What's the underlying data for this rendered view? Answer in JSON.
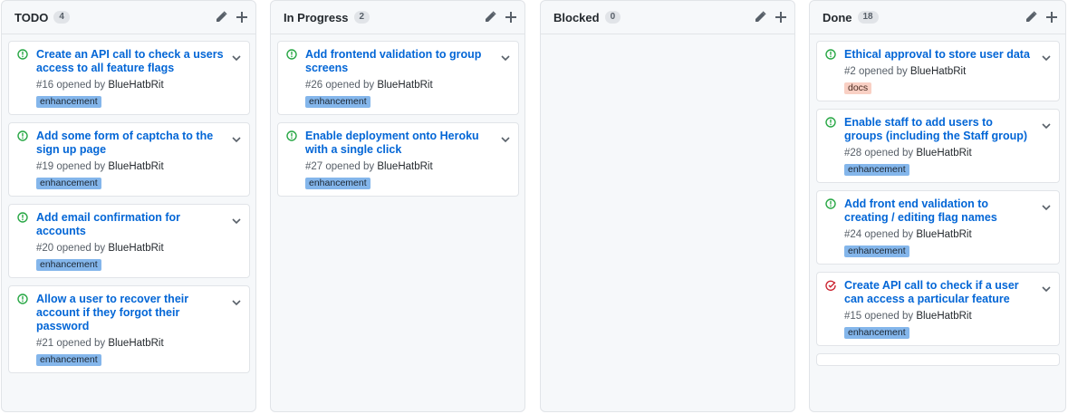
{
  "colors": {
    "open_icon": "#28a745",
    "closed_icon": "#cb2431",
    "title_link": "#0366d6",
    "enhancement_bg": "#84b6eb",
    "docs_bg": "#f9d0c4"
  },
  "columns": [
    {
      "title": "TODO",
      "count": "4",
      "cards": [
        {
          "title": "Create an API call to check a users access to all feature flags",
          "number": "#16",
          "opened_by": "opened by",
          "author": "BlueHatbRit",
          "label": "enhancement",
          "icon": "issue-opened-icon"
        },
        {
          "title": "Add some form of captcha to the sign up page",
          "number": "#19",
          "opened_by": "opened by",
          "author": "BlueHatbRit",
          "label": "enhancement",
          "icon": "issue-opened-icon"
        },
        {
          "title": "Add email confirmation for accounts",
          "number": "#20",
          "opened_by": "opened by",
          "author": "BlueHatbRit",
          "label": "enhancement",
          "icon": "issue-opened-icon"
        },
        {
          "title": "Allow a user to recover their account if they forgot their password",
          "number": "#21",
          "opened_by": "opened by",
          "author": "BlueHatbRit",
          "label": "enhancement",
          "icon": "issue-opened-icon"
        }
      ]
    },
    {
      "title": "In Progress",
      "count": "2",
      "cards": [
        {
          "title": "Add frontend validation to group screens",
          "number": "#26",
          "opened_by": "opened by",
          "author": "BlueHatbRit",
          "label": "enhancement",
          "icon": "issue-opened-icon"
        },
        {
          "title": "Enable deployment onto Heroku with a single click",
          "number": "#27",
          "opened_by": "opened by",
          "author": "BlueHatbRit",
          "label": "enhancement",
          "icon": "issue-opened-icon"
        }
      ]
    },
    {
      "title": "Blocked",
      "count": "0",
      "cards": []
    },
    {
      "title": "Done",
      "count": "18",
      "cards": [
        {
          "title": "Ethical approval to store user data",
          "number": "#2",
          "opened_by": "opened by",
          "author": "BlueHatbRit",
          "label": "docs",
          "icon": "issue-opened-icon"
        },
        {
          "title": "Enable staff to add users to groups (including the Staff group)",
          "number": "#28",
          "opened_by": "opened by",
          "author": "BlueHatbRit",
          "label": "enhancement",
          "icon": "issue-opened-icon"
        },
        {
          "title": "Add front end validation to creating / editing flag names",
          "number": "#24",
          "opened_by": "opened by",
          "author": "BlueHatbRit",
          "label": "enhancement",
          "icon": "issue-opened-icon"
        },
        {
          "title": "Create API call to check if a user can access a particular feature",
          "number": "#15",
          "opened_by": "opened by",
          "author": "BlueHatbRit",
          "label": "enhancement",
          "icon": "issue-closed-icon"
        }
      ]
    }
  ]
}
